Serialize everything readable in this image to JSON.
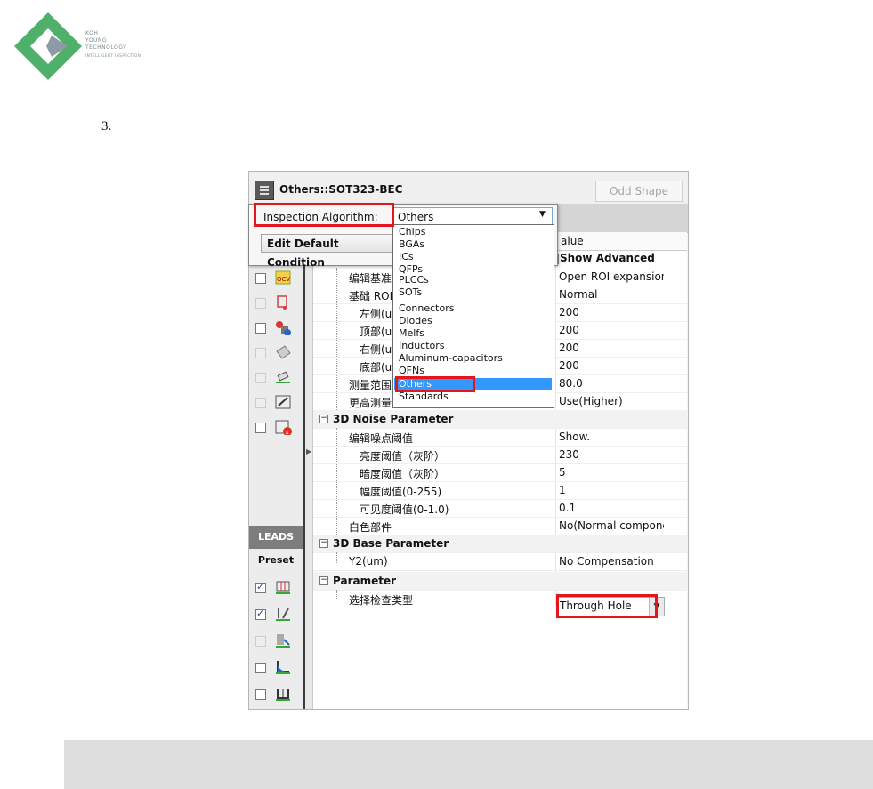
{
  "logo": {
    "line1": "KOH",
    "line2": "YOUNG",
    "line3": "TECHNOLOGY",
    "tagline": "INTELLIGENT INSPECTION",
    "colors": {
      "green": "#4fb06a",
      "gray": "#8d9aa8"
    }
  },
  "step_number": "3.",
  "window": {
    "title": "Others::SOT323-BEC",
    "odd_shape_label": "Odd Shape"
  },
  "popup": {
    "algorithm_label": "Inspection Algorithm:",
    "algorithm_value": "Others",
    "edit_default_label": "Edit Default Condition"
  },
  "dropdown": {
    "options": [
      "Chips",
      "BGAs",
      "ICs",
      "QFPs",
      "PLCCs",
      "SOTs",
      "Connectors",
      "Diodes",
      "Melfs",
      "Inductors",
      "Aluminum-capacitors",
      "QFNs",
      "Others",
      "Standards"
    ],
    "selected": "Others"
  },
  "grid": {
    "value_header": "alue",
    "show_advanced": "Show Advanced",
    "rows": [
      {
        "key": "编辑基准面",
        "value": "Open ROI expansion"
      },
      {
        "key": "基础 ROI I",
        "value": "Normal"
      },
      {
        "key": "左侧(um",
        "value": "200"
      },
      {
        "key": "顶部(um",
        "value": "200"
      },
      {
        "key": "右侧(um",
        "value": "200"
      },
      {
        "key": "底部(um",
        "value": "200"
      },
      {
        "key": "测量范围(",
        "value": "80.0"
      },
      {
        "key": "更高测量",
        "value": "Use(Higher)"
      }
    ],
    "noise_category": "3D Noise Parameter",
    "noise_rows": [
      {
        "key": "编辑噪点阈值",
        "value": "Show."
      },
      {
        "key": "亮度阈值（灰阶）",
        "value": "230"
      },
      {
        "key": "暗度阈值（灰阶）",
        "value": "5"
      },
      {
        "key": "幅度阈值(0-255)",
        "value": "1"
      },
      {
        "key": "可见度阈值(0-1.0)",
        "value": "0.1"
      },
      {
        "key": "白色部件",
        "value": "No(Normal compone"
      }
    ],
    "base_category": "3D Base Parameter",
    "base_rows": [
      {
        "key": "Y2(um)",
        "value": "No Compensation"
      }
    ],
    "param_category": "Parameter",
    "param_rows": [
      {
        "key": "选择检查类型",
        "value": "Through Hole"
      }
    ]
  },
  "toolbar": {
    "leads_label": "LEADS",
    "preset_label": "Preset",
    "icons": [
      "ocv-icon"
    ]
  },
  "colors": {
    "highlight_red": "#e3161b",
    "selection_blue": "#3399ff",
    "leads_tab": "#7d7d7d"
  }
}
